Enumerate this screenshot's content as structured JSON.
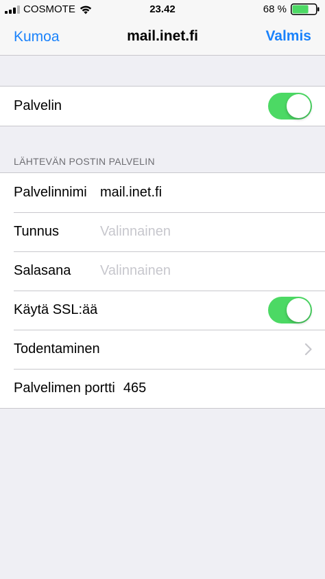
{
  "status_bar": {
    "carrier": "COSMOTE",
    "time": "23.42",
    "battery_percent_text": "68 %",
    "battery_level": 0.68,
    "signal_icon": "signal-bars-icon",
    "wifi_icon": "wifi-icon",
    "battery_icon": "battery-icon"
  },
  "nav": {
    "cancel_label": "Kumoa",
    "title": "mail.inet.fi",
    "done_label": "Valmis"
  },
  "colors": {
    "accent": "#1a82fb",
    "toggle_on": "#4cd964",
    "background": "#efeff4",
    "placeholder": "#c7c7cd"
  },
  "server_group": {
    "server_label": "Palvelin",
    "server_enabled": true
  },
  "outgoing_section": {
    "header": "LÄHTEVÄN POSTIN PALVELIN",
    "hostname_label": "Palvelinnimi",
    "hostname_value": "mail.inet.fi",
    "username_label": "Tunnus",
    "username_placeholder": "Valinnainen",
    "password_label": "Salasana",
    "password_placeholder": "Valinnainen",
    "ssl_label": "Käytä SSL:ää",
    "ssl_enabled": true,
    "auth_label": "Todentaminen",
    "port_label": "Palvelimen portti",
    "port_value": "465"
  }
}
